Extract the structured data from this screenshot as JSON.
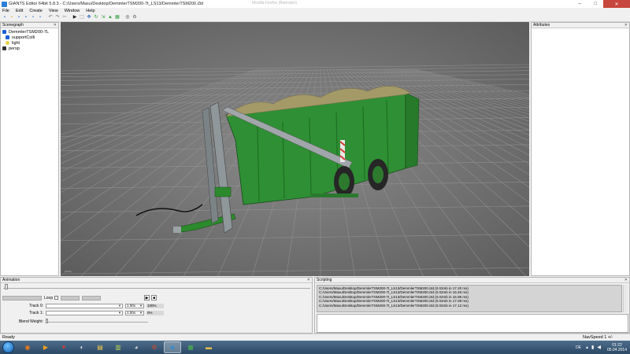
{
  "window": {
    "title": "GIANTS Editor 64bit 5.8.3 - C:/Users/Maxu/Desktop/DemmlerTSM200-7t_LS13/DemmlerTSM200.i3d",
    "ghost_tab": "Mozilla Firefox (Beenden)",
    "minimize": "–",
    "maximize": "□",
    "close": "✕"
  },
  "menu": [
    "File",
    "Edit",
    "Create",
    "View",
    "Window",
    "Help"
  ],
  "toolbar_icons": [
    {
      "name": "new-icon",
      "glyph": "▪",
      "color": "#3a7bd5"
    },
    {
      "name": "open-icon",
      "glyph": "▪",
      "color": "#e1b53a"
    },
    {
      "name": "save-icon",
      "glyph": "▪",
      "color": "#3a7bd5"
    },
    {
      "name": "save-as-icon",
      "glyph": "▪",
      "color": "#3a7bd5"
    },
    {
      "name": "import-icon",
      "glyph": "▪",
      "color": "#5a8ed6"
    },
    {
      "name": "export-icon",
      "glyph": "▪",
      "color": "#5a8ed6"
    },
    {
      "name": "undo-icon",
      "glyph": "↶",
      "color": "#777777"
    },
    {
      "name": "redo-icon",
      "glyph": "↷",
      "color": "#777777"
    },
    {
      "name": "cut-icon",
      "glyph": "✂",
      "color": "#888888"
    },
    {
      "name": "play-icon",
      "glyph": "▶",
      "color": "#222222"
    },
    {
      "name": "select-icon",
      "glyph": "⬚",
      "color": "#444444"
    },
    {
      "name": "move-icon",
      "glyph": "✥",
      "color": "#2b63b8"
    },
    {
      "name": "rotate-icon",
      "glyph": "↻",
      "color": "#2e9c3a"
    },
    {
      "name": "scale-icon",
      "glyph": "⇲",
      "color": "#2e9c3a"
    },
    {
      "name": "terrain-icon",
      "glyph": "▲",
      "color": "#2e9c3a"
    },
    {
      "name": "paint-icon",
      "glyph": "▦",
      "color": "#2e9c3a"
    },
    {
      "name": "camera-icon",
      "glyph": "◎",
      "color": "#444444"
    },
    {
      "name": "settings-icon",
      "glyph": "⚙",
      "color": "#666666"
    }
  ],
  "scenegraph": {
    "title": "Scenegraph",
    "close": "✕",
    "items": [
      {
        "label": "DemmlerTSM200-7L",
        "icon_color": "#1a5fd6"
      },
      {
        "label": "supportColli",
        "icon_color": "#1a5fd6"
      },
      {
        "label": "light",
        "icon_color": "#e8d44a"
      },
      {
        "label": "persp",
        "icon_color": "#333333"
      }
    ]
  },
  "attributes": {
    "title": "Attributes",
    "close": "✕"
  },
  "viewport": {
    "corner_label": "persp"
  },
  "animation": {
    "title": "Animation",
    "close": "✕",
    "loop_label": "Loop",
    "track0_label": "Track 0:",
    "track1_label": "Track 1:",
    "blend_label": "Blend Weight:",
    "track0_speed": "1.00x",
    "track1_speed": "1.00x",
    "track0_pct": "100%",
    "track1_pct": "0%",
    "play": "▶",
    "stop": "■",
    "dropdown": "▼"
  },
  "scripting": {
    "title": "Scripting",
    "close": "✕",
    "lines": [
      "C:/Users/Maxu/Desktop/DemmlerTSM200-7t_LS13/DemmlerTSM200.i3d (0.02mb in 17.20 ms)",
      "C:/Users/Maxu/Desktop/DemmlerTSM200-7t_LS13/DemmlerTSM200.i3d (0.02mb in 16.46 ms)",
      "C:/Users/Maxu/Desktop/DemmlerTSM200-7t_LS13/DemmlerTSM200.i3d (0.02mb in 16.96 ms)",
      "C:/Users/Maxu/Desktop/DemmlerTSM200-7t_LS13/DemmlerTSM200.i3d (0.02mb in 17.08 ms)",
      "C:/Users/Maxu/Desktop/DemmlerTSM200-7t_LS13/DemmlerTSM200.i3d (0.02mb in 17.12 ms)"
    ]
  },
  "status": {
    "left": "Ready",
    "right": "NavSpeed 1 +/-"
  },
  "taskbar": {
    "apps": [
      {
        "name": "firefox-taskbar-icon",
        "glyph": "◉",
        "color": "#f07b1a",
        "active": false
      },
      {
        "name": "media-player-taskbar-icon",
        "glyph": "▶",
        "color": "#f0a020",
        "active": false
      },
      {
        "name": "game-taskbar-icon",
        "glyph": "✦",
        "color": "#e33b2e",
        "active": false
      },
      {
        "name": "steam-taskbar-icon",
        "glyph": "◐",
        "color": "#dddddd",
        "active": false
      },
      {
        "name": "explorer-taskbar-icon",
        "glyph": "▤",
        "color": "#f2c94c",
        "active": false
      },
      {
        "name": "farm-taskbar-icon",
        "glyph": "▥",
        "color": "#b5cf5a",
        "active": false
      },
      {
        "name": "teamspeak-taskbar-icon",
        "glyph": "◕",
        "color": "#cfcfcf",
        "active": false
      },
      {
        "name": "gear-app-taskbar-icon",
        "glyph": "⚙",
        "color": "#d24d2b",
        "active": false
      },
      {
        "name": "giants-editor-taskbar-icon",
        "glyph": "◈",
        "color": "#2f8ad8",
        "active": true
      },
      {
        "name": "excel-taskbar-icon",
        "glyph": "▦",
        "color": "#4caf50",
        "active": false
      },
      {
        "name": "folder-taskbar-icon",
        "glyph": "▬",
        "color": "#e6c04a",
        "active": false
      }
    ],
    "language": "DE",
    "time": "01:22",
    "date": "05.04.2014"
  }
}
